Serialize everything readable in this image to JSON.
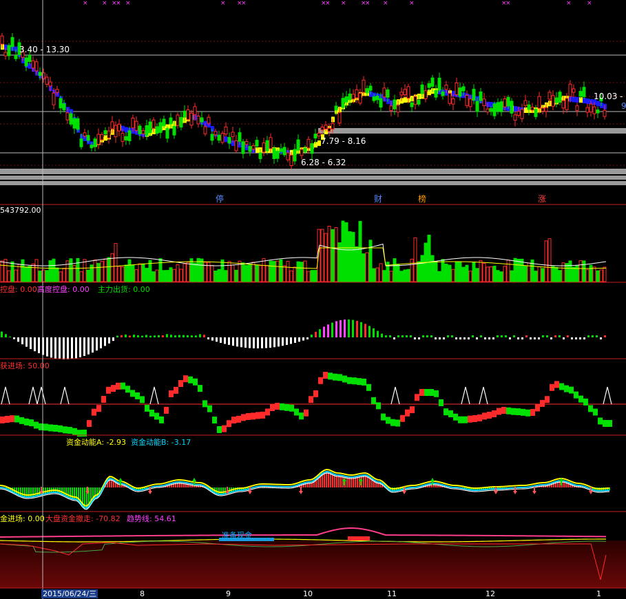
{
  "colors": {
    "bg": "#000000",
    "divider": "#c81e1e",
    "grid": "#7a1010",
    "up": "#ff2b2b",
    "down": "#00e000",
    "bluebar": "#1a1aff",
    "yellow": "#ffff00",
    "white": "#ffffff",
    "cyan": "#00d8ff",
    "magenta": "#ff40ff",
    "pink": "#ff3c8c",
    "orange": "#ff9900"
  },
  "panel1": {
    "label_high": "3.40 - 13.30",
    "label_mid1": "7.79 - 8.16",
    "label_mid2": "6.28 - 6.32",
    "label_right": "10.03 -",
    "label_right_edge": "9",
    "event_labels": [
      "停",
      "财",
      "榜",
      "涨"
    ]
  },
  "panel2": {
    "header": "543792.00"
  },
  "panel3": {
    "item1_label": "控盘: 0.00",
    "item2_label": "高度控盘: 0.00",
    "item3_label": "主力出货: 0.00"
  },
  "panel4": {
    "header": "获进场: 50.00"
  },
  "panel5": {
    "item1_label": "资金动能A: -2.93",
    "item2_label": "资金动能B: -3.17"
  },
  "panel6": {
    "item1_label": "金进场: 0.00",
    "item2_label": "大盘资金撤走: -70.82",
    "item3_label": "趋势线: 54.61",
    "annotation": "准备现金"
  },
  "xaxis": {
    "cursor_date": "2015/06/24/三",
    "months": [
      "8",
      "9",
      "10",
      "11",
      "12",
      "1"
    ]
  },
  "chart_data": {
    "type": "candlestick",
    "note": "daily stock chart with multiple indicator panels",
    "price_range": [
      6.28,
      13.3
    ],
    "levels": [
      {
        "label": "3.40 - 13.30",
        "price": 13.3
      },
      {
        "label": "7.79 - 8.16",
        "price": 8.16
      },
      {
        "label": "6.28 - 6.32",
        "price": 6.32
      },
      {
        "label": "10.03 -",
        "price": 10.03
      }
    ],
    "volume_max": 543792.0,
    "indicators": {
      "控盘": 0.0,
      "高度控盘": 0.0,
      "主力出货": 0.0,
      "获进场": 50.0,
      "资金动能A": -2.93,
      "资金动能B": -3.17,
      "金进场": 0.0,
      "大盘资金撤走": -70.82,
      "趋势线": 54.61
    },
    "x_ticks": [
      "8",
      "9",
      "10",
      "11",
      "12",
      "1"
    ]
  }
}
